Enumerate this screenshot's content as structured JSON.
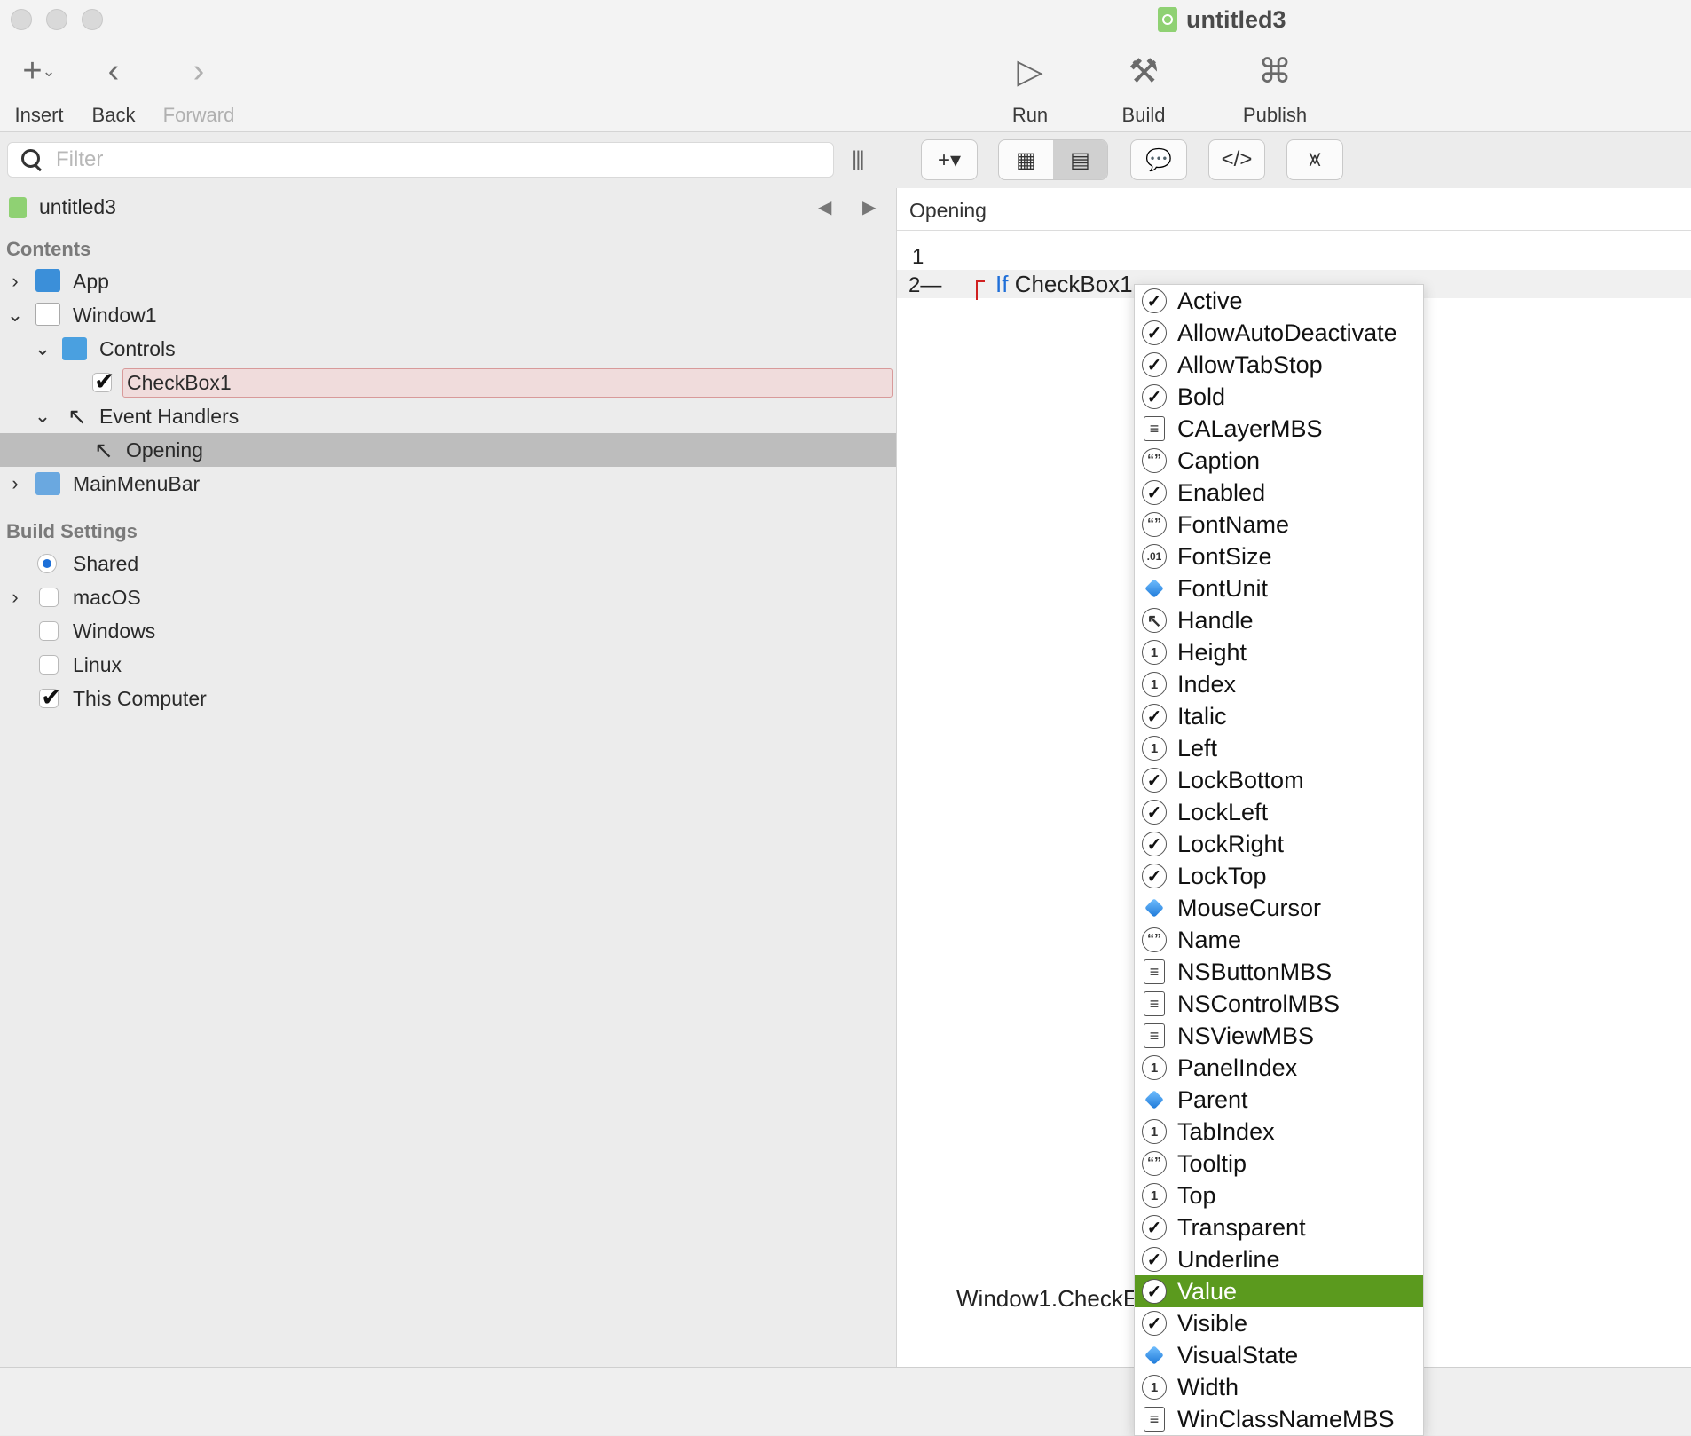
{
  "window": {
    "title": "untitled3"
  },
  "toolbar": {
    "insert": "Insert",
    "back": "Back",
    "forward": "Forward",
    "run": "Run",
    "build": "Build",
    "publish": "Publish"
  },
  "filter": {
    "placeholder": "Filter"
  },
  "navigator": {
    "project": "untitled3",
    "contents_header": "Contents",
    "items": {
      "app": "App",
      "window1": "Window1",
      "controls": "Controls",
      "checkbox1": "CheckBox1",
      "event_handlers": "Event Handlers",
      "opening": "Opening",
      "mainmenubar": "MainMenuBar"
    },
    "build_settings_header": "Build Settings",
    "build": {
      "shared": "Shared",
      "macos": "macOS",
      "windows": "Windows",
      "linux": "Linux",
      "this_computer": "This Computer"
    }
  },
  "editor": {
    "method_name": "Opening",
    "line1": "1",
    "line2": "2",
    "keyword": "If",
    "code_text": "CheckBox1",
    "footer_text": "Window1.CheckE"
  },
  "autocomplete": {
    "selected": "Value",
    "items": [
      {
        "name": "Active",
        "icon": "check"
      },
      {
        "name": "AllowAutoDeactivate",
        "icon": "check"
      },
      {
        "name": "AllowTabStop",
        "icon": "check"
      },
      {
        "name": "Bold",
        "icon": "check"
      },
      {
        "name": "CALayerMBS",
        "icon": "doc"
      },
      {
        "name": "Caption",
        "icon": "quote"
      },
      {
        "name": "Enabled",
        "icon": "check"
      },
      {
        "name": "FontName",
        "icon": "quote"
      },
      {
        "name": "FontSize",
        "icon": "dec"
      },
      {
        "name": "FontUnit",
        "icon": "cube"
      },
      {
        "name": "Handle",
        "icon": "ptr"
      },
      {
        "name": "Height",
        "icon": "num"
      },
      {
        "name": "Index",
        "icon": "num"
      },
      {
        "name": "Italic",
        "icon": "check"
      },
      {
        "name": "Left",
        "icon": "num"
      },
      {
        "name": "LockBottom",
        "icon": "check"
      },
      {
        "name": "LockLeft",
        "icon": "check"
      },
      {
        "name": "LockRight",
        "icon": "check"
      },
      {
        "name": "LockTop",
        "icon": "check"
      },
      {
        "name": "MouseCursor",
        "icon": "cube"
      },
      {
        "name": "Name",
        "icon": "quote"
      },
      {
        "name": "NSButtonMBS",
        "icon": "doc"
      },
      {
        "name": "NSControlMBS",
        "icon": "doc"
      },
      {
        "name": "NSViewMBS",
        "icon": "doc"
      },
      {
        "name": "PanelIndex",
        "icon": "num"
      },
      {
        "name": "Parent",
        "icon": "cube"
      },
      {
        "name": "TabIndex",
        "icon": "num"
      },
      {
        "name": "Tooltip",
        "icon": "quote"
      },
      {
        "name": "Top",
        "icon": "num"
      },
      {
        "name": "Transparent",
        "icon": "check"
      },
      {
        "name": "Underline",
        "icon": "check"
      },
      {
        "name": "Value",
        "icon": "check"
      },
      {
        "name": "Visible",
        "icon": "check"
      },
      {
        "name": "VisualState",
        "icon": "cube"
      },
      {
        "name": "Width",
        "icon": "num"
      },
      {
        "name": "WinClassNameMBS",
        "icon": "doc"
      }
    ]
  },
  "colors": {
    "selection_green": "#5b9a1e",
    "keyword_blue": "#1f6fd8",
    "rename_bg": "#f0dcdc"
  }
}
